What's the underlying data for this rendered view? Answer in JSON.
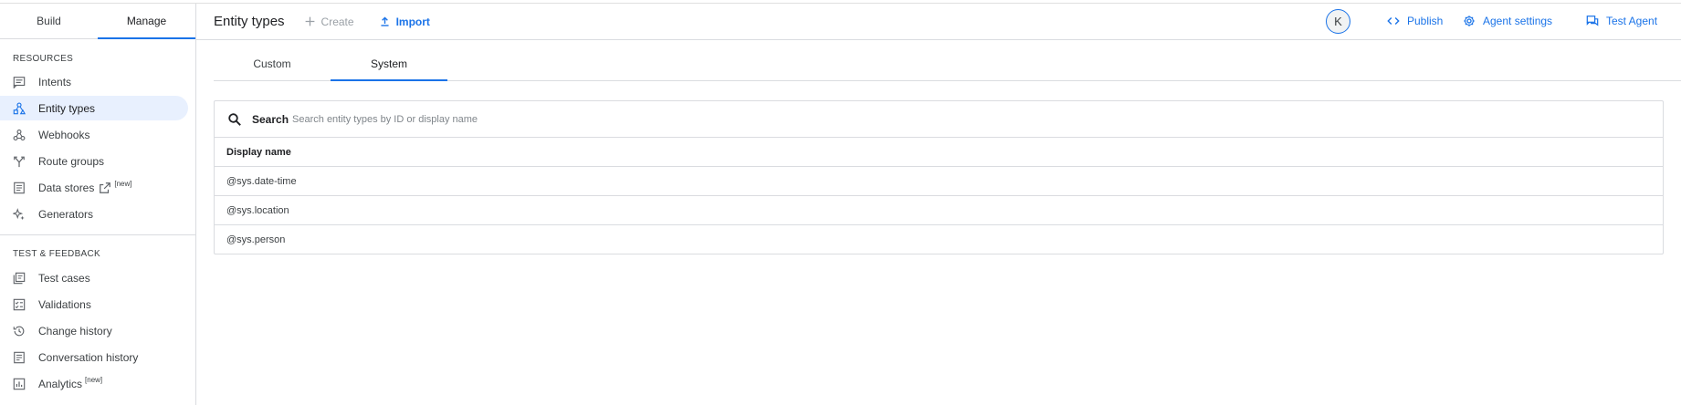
{
  "sidebar": {
    "mode_tabs": [
      {
        "label": "Build",
        "active": false
      },
      {
        "label": "Manage",
        "active": true
      }
    ],
    "resources_title": "RESOURCES",
    "resources": [
      {
        "label": "Intents",
        "icon": "intent-icon"
      },
      {
        "label": "Entity types",
        "icon": "entity-types-icon",
        "active": true
      },
      {
        "label": "Webhooks",
        "icon": "webhook-icon"
      },
      {
        "label": "Route groups",
        "icon": "route-groups-icon"
      },
      {
        "label": "Data stores",
        "icon": "data-stores-icon",
        "badge": "[new]"
      },
      {
        "label": "Generators",
        "icon": "generators-icon"
      }
    ],
    "test_title": "TEST & FEEDBACK",
    "test": [
      {
        "label": "Test cases",
        "icon": "test-cases-icon"
      },
      {
        "label": "Validations",
        "icon": "validations-icon"
      },
      {
        "label": "Change history",
        "icon": "history-icon"
      },
      {
        "label": "Conversation history",
        "icon": "conversation-history-icon"
      },
      {
        "label": "Analytics",
        "icon": "analytics-icon",
        "badge": "[new]"
      }
    ]
  },
  "header": {
    "title": "Entity types",
    "create_label": "Create",
    "import_label": "Import",
    "avatar_initial": "K",
    "publish_label": "Publish",
    "agent_settings_label": "Agent settings",
    "test_agent_label": "Test Agent"
  },
  "content_tabs": [
    {
      "label": "Custom",
      "active": false
    },
    {
      "label": "System",
      "active": true
    }
  ],
  "search": {
    "label": "Search",
    "placeholder": "Search entity types by ID or display name"
  },
  "table": {
    "column_header": "Display name",
    "rows": [
      "@sys.date-time",
      "@sys.location",
      "@sys.person"
    ]
  },
  "colors": {
    "accent": "#1a73e8",
    "active_nav_bg": "#e8f0fe",
    "border": "#dadce0"
  }
}
